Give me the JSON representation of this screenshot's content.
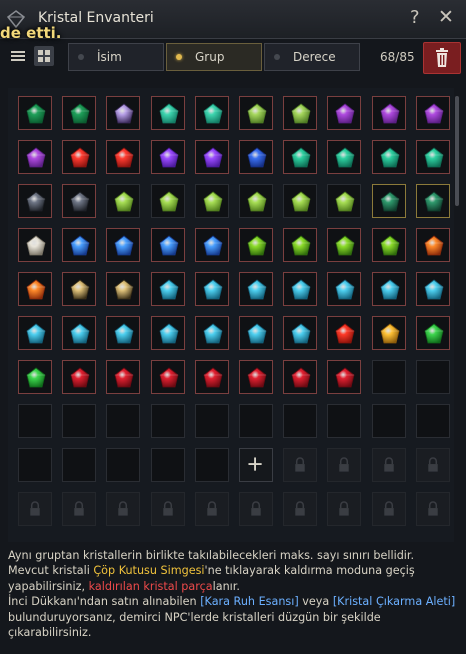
{
  "window": {
    "title": "Kristal Envanteri",
    "help_icon": "question-icon",
    "close_icon": "close-icon",
    "toast": "de etti."
  },
  "toolbar": {
    "view_modes": [
      "list-view-icon",
      "grid-view-icon"
    ],
    "sort_tabs": [
      {
        "label": "İsim",
        "active": false
      },
      {
        "label": "Grup",
        "active": true
      },
      {
        "label": "Derece",
        "active": false
      }
    ],
    "count": "68/85",
    "trash_icon": "trash-icon"
  },
  "grid": {
    "columns": 10,
    "rows": [
      [
        "emerald-green",
        "emerald-green",
        "shard-violet",
        "gem-aqua",
        "gem-aqua",
        "gem-lime",
        "gem-lime",
        "amethyst-purple",
        "amethyst-purple",
        "amethyst-purple"
      ],
      [
        "amethyst-purple",
        "ruby-red",
        "ruby-red",
        "crystal-violet",
        "crystal-violet",
        "sapphire-blue",
        "emerald-teal",
        "emerald-teal",
        "emerald-teal",
        "emerald-teal"
      ],
      [
        "egg-black",
        "egg-black",
        "peridot-lime",
        "peridot-lime",
        "peridot-lime",
        "peridot-lime",
        "peridot-lime",
        "peridot-lime",
        "emerald-dark",
        "emerald-dark"
      ],
      [
        "cube-white",
        "flare-blue",
        "flare-blue",
        "flare-blue",
        "flare-blue",
        "flare-green",
        "flare-green",
        "flare-green",
        "flare-green",
        "flame-orange"
      ],
      [
        "flame-orange",
        "swirl-gold",
        "swirl-gold",
        "drop-cyan",
        "drop-cyan",
        "drop-cyan",
        "drop-cyan",
        "drop-cyan",
        "drop-cyan",
        "drop-cyan"
      ],
      [
        "drop-cyan",
        "drop-cyan",
        "drop-cyan",
        "drop-cyan",
        "drop-cyan",
        "drop-cyan",
        "drop-cyan",
        "orb-red",
        "orb-gold",
        "gem-green"
      ],
      [
        "gem-green",
        "garnet-red",
        "garnet-red",
        "garnet-red",
        "garnet-red",
        "garnet-red",
        "garnet-red",
        "garnet-red",
        "empty",
        "empty"
      ],
      [
        "empty",
        "empty",
        "empty",
        "empty",
        "empty",
        "empty",
        "empty",
        "empty",
        "empty",
        "empty"
      ],
      [
        "empty",
        "empty",
        "empty",
        "empty",
        "empty",
        "add",
        "locked",
        "locked",
        "locked",
        "locked"
      ],
      [
        "locked",
        "locked",
        "locked",
        "locked",
        "locked",
        "locked",
        "locked",
        "locked",
        "locked",
        "locked"
      ]
    ],
    "add_icon": "plus-icon",
    "lock_icon": "lock-icon"
  },
  "footer": {
    "line1": "Aynı gruptan kristallerin birlikte takılabilecekleri maks. sayı sınırı bellidir.",
    "line2_a": "Mevcut kristali ",
    "line2_b": "Çöp Kutusu Simgesi",
    "line2_c": "'ne tıklayarak kaldırma moduna geçiş yapabilirsiniz, ",
    "line2_d": "kaldırılan kristal parça",
    "line2_e": "lanır.",
    "line3_a": "İnci Dükkanı'ndan satın alınabilen ",
    "line3_b": "[Kara Ruh Esansı]",
    "line3_c": " veya ",
    "line3_d": "[Kristal Çıkarma Aleti]",
    "line3_e": " bulunduruyorsanız, demirci NPC'lerde kristalleri düzgün bir şekilde çıkarabilirsiniz."
  },
  "colors": {
    "highlight_yellow": "#f0c23c",
    "highlight_red": "#ec4a4a",
    "highlight_blue": "#6cb0ff",
    "accent_gold": "#e1b94e"
  }
}
